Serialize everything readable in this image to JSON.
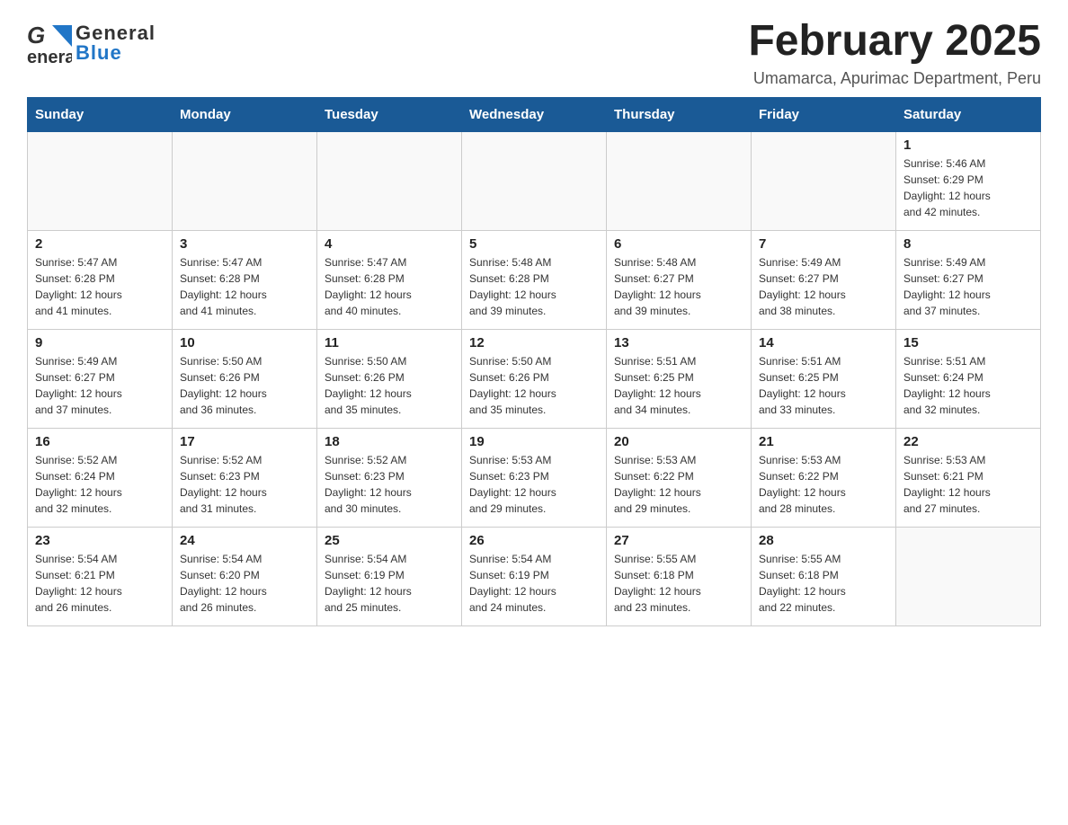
{
  "header": {
    "title": "February 2025",
    "subtitle": "Umamarca, Apurimac Department, Peru",
    "logo_general": "General",
    "logo_blue": "Blue"
  },
  "weekdays": [
    "Sunday",
    "Monday",
    "Tuesday",
    "Wednesday",
    "Thursday",
    "Friday",
    "Saturday"
  ],
  "weeks": [
    [
      {
        "day": "",
        "info": ""
      },
      {
        "day": "",
        "info": ""
      },
      {
        "day": "",
        "info": ""
      },
      {
        "day": "",
        "info": ""
      },
      {
        "day": "",
        "info": ""
      },
      {
        "day": "",
        "info": ""
      },
      {
        "day": "1",
        "info": "Sunrise: 5:46 AM\nSunset: 6:29 PM\nDaylight: 12 hours\nand 42 minutes."
      }
    ],
    [
      {
        "day": "2",
        "info": "Sunrise: 5:47 AM\nSunset: 6:28 PM\nDaylight: 12 hours\nand 41 minutes."
      },
      {
        "day": "3",
        "info": "Sunrise: 5:47 AM\nSunset: 6:28 PM\nDaylight: 12 hours\nand 41 minutes."
      },
      {
        "day": "4",
        "info": "Sunrise: 5:47 AM\nSunset: 6:28 PM\nDaylight: 12 hours\nand 40 minutes."
      },
      {
        "day": "5",
        "info": "Sunrise: 5:48 AM\nSunset: 6:28 PM\nDaylight: 12 hours\nand 39 minutes."
      },
      {
        "day": "6",
        "info": "Sunrise: 5:48 AM\nSunset: 6:27 PM\nDaylight: 12 hours\nand 39 minutes."
      },
      {
        "day": "7",
        "info": "Sunrise: 5:49 AM\nSunset: 6:27 PM\nDaylight: 12 hours\nand 38 minutes."
      },
      {
        "day": "8",
        "info": "Sunrise: 5:49 AM\nSunset: 6:27 PM\nDaylight: 12 hours\nand 37 minutes."
      }
    ],
    [
      {
        "day": "9",
        "info": "Sunrise: 5:49 AM\nSunset: 6:27 PM\nDaylight: 12 hours\nand 37 minutes."
      },
      {
        "day": "10",
        "info": "Sunrise: 5:50 AM\nSunset: 6:26 PM\nDaylight: 12 hours\nand 36 minutes."
      },
      {
        "day": "11",
        "info": "Sunrise: 5:50 AM\nSunset: 6:26 PM\nDaylight: 12 hours\nand 35 minutes."
      },
      {
        "day": "12",
        "info": "Sunrise: 5:50 AM\nSunset: 6:26 PM\nDaylight: 12 hours\nand 35 minutes."
      },
      {
        "day": "13",
        "info": "Sunrise: 5:51 AM\nSunset: 6:25 PM\nDaylight: 12 hours\nand 34 minutes."
      },
      {
        "day": "14",
        "info": "Sunrise: 5:51 AM\nSunset: 6:25 PM\nDaylight: 12 hours\nand 33 minutes."
      },
      {
        "day": "15",
        "info": "Sunrise: 5:51 AM\nSunset: 6:24 PM\nDaylight: 12 hours\nand 32 minutes."
      }
    ],
    [
      {
        "day": "16",
        "info": "Sunrise: 5:52 AM\nSunset: 6:24 PM\nDaylight: 12 hours\nand 32 minutes."
      },
      {
        "day": "17",
        "info": "Sunrise: 5:52 AM\nSunset: 6:23 PM\nDaylight: 12 hours\nand 31 minutes."
      },
      {
        "day": "18",
        "info": "Sunrise: 5:52 AM\nSunset: 6:23 PM\nDaylight: 12 hours\nand 30 minutes."
      },
      {
        "day": "19",
        "info": "Sunrise: 5:53 AM\nSunset: 6:23 PM\nDaylight: 12 hours\nand 29 minutes."
      },
      {
        "day": "20",
        "info": "Sunrise: 5:53 AM\nSunset: 6:22 PM\nDaylight: 12 hours\nand 29 minutes."
      },
      {
        "day": "21",
        "info": "Sunrise: 5:53 AM\nSunset: 6:22 PM\nDaylight: 12 hours\nand 28 minutes."
      },
      {
        "day": "22",
        "info": "Sunrise: 5:53 AM\nSunset: 6:21 PM\nDaylight: 12 hours\nand 27 minutes."
      }
    ],
    [
      {
        "day": "23",
        "info": "Sunrise: 5:54 AM\nSunset: 6:21 PM\nDaylight: 12 hours\nand 26 minutes."
      },
      {
        "day": "24",
        "info": "Sunrise: 5:54 AM\nSunset: 6:20 PM\nDaylight: 12 hours\nand 26 minutes."
      },
      {
        "day": "25",
        "info": "Sunrise: 5:54 AM\nSunset: 6:19 PM\nDaylight: 12 hours\nand 25 minutes."
      },
      {
        "day": "26",
        "info": "Sunrise: 5:54 AM\nSunset: 6:19 PM\nDaylight: 12 hours\nand 24 minutes."
      },
      {
        "day": "27",
        "info": "Sunrise: 5:55 AM\nSunset: 6:18 PM\nDaylight: 12 hours\nand 23 minutes."
      },
      {
        "day": "28",
        "info": "Sunrise: 5:55 AM\nSunset: 6:18 PM\nDaylight: 12 hours\nand 22 minutes."
      },
      {
        "day": "",
        "info": ""
      }
    ]
  ]
}
